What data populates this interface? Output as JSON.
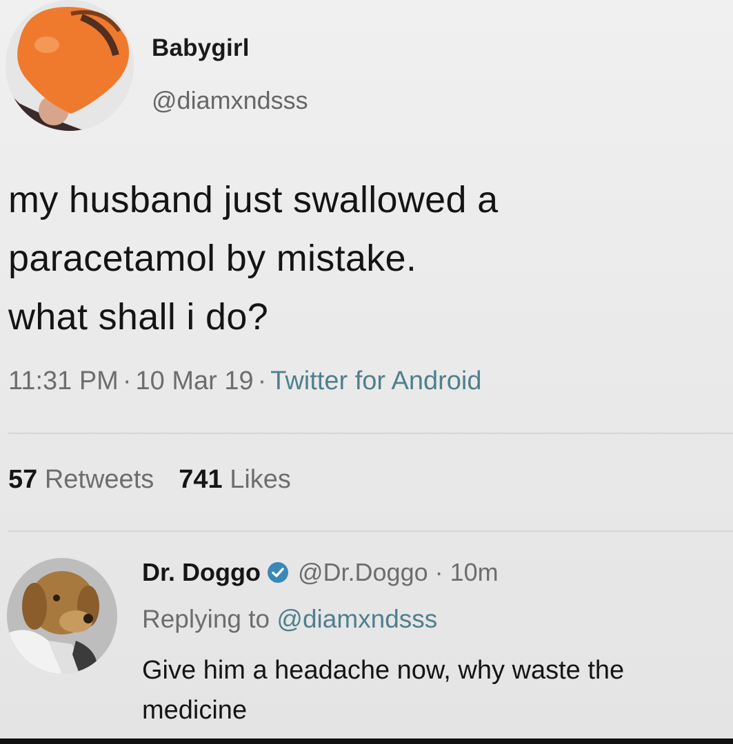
{
  "tweet": {
    "author_name": "Babygirl",
    "author_handle": "@diamxndsss",
    "avatar_icon": "orange-heart-avatar-icon",
    "text_lines": [
      "my husband just swallowed a",
      "paracetamol by mistake.",
      "what shall i do?"
    ],
    "time": "11:31 PM",
    "date": "10 Mar 19",
    "separator": "·",
    "source": "Twitter for Android",
    "retweets_count": "57",
    "retweets_label": "Retweets",
    "likes_count": "741",
    "likes_label": "Likes"
  },
  "reply": {
    "author_name": "Dr. Doggo",
    "verified_icon": "verified-badge-icon",
    "author_handle": "@Dr.Doggo",
    "separator": "·",
    "time": "10m",
    "replying_prefix": "Replying to",
    "replying_to": "@diamxndsss",
    "avatar_icon": "dog-doctor-avatar-icon",
    "text_lines": [
      "Give him a headache now, why waste the",
      "medicine"
    ]
  },
  "colors": {
    "background": "#ebebeb",
    "link": "#4f7f8e",
    "verified": "#3a87b8",
    "avatar_orange": "#ef7a2e"
  }
}
